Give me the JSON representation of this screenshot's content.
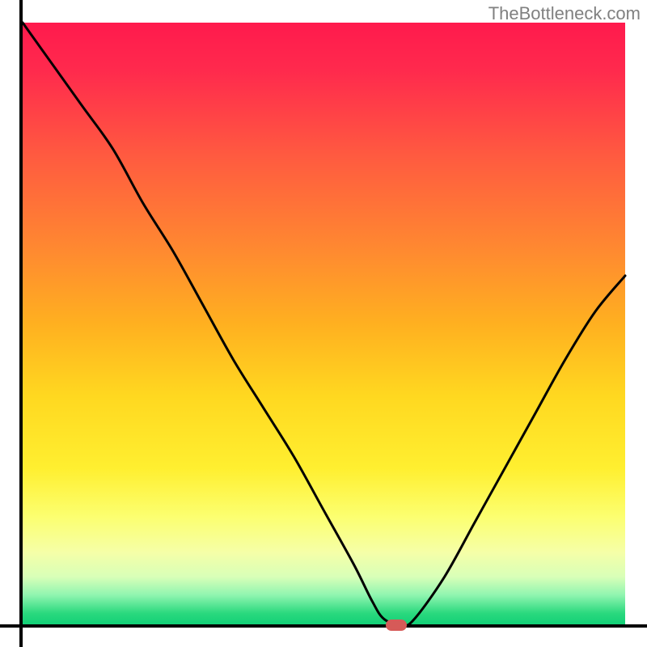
{
  "watermark": "TheBottleneck.com",
  "chart_data": {
    "type": "line",
    "title": "",
    "xlabel": "",
    "ylabel": "",
    "xlim": [
      0,
      100
    ],
    "ylim": [
      0,
      100
    ],
    "grid": false,
    "legend": false,
    "background_gradient": {
      "orientation": "vertical",
      "stops": [
        {
          "pos": 0.0,
          "color": "#ff1a4d"
        },
        {
          "pos": 0.08,
          "color": "#ff2a4d"
        },
        {
          "pos": 0.22,
          "color": "#ff5a40"
        },
        {
          "pos": 0.38,
          "color": "#ff8a30"
        },
        {
          "pos": 0.5,
          "color": "#ffb020"
        },
        {
          "pos": 0.62,
          "color": "#ffd820"
        },
        {
          "pos": 0.74,
          "color": "#ffef30"
        },
        {
          "pos": 0.82,
          "color": "#fcff70"
        },
        {
          "pos": 0.88,
          "color": "#f5ffa8"
        },
        {
          "pos": 0.92,
          "color": "#d8ffb8"
        },
        {
          "pos": 0.95,
          "color": "#90f5b0"
        },
        {
          "pos": 0.98,
          "color": "#2bd97e"
        },
        {
          "pos": 1.0,
          "color": "#10cf76"
        }
      ]
    },
    "series": [
      {
        "name": "bottleneck-curve",
        "color": "#000000",
        "x": [
          0,
          5,
          10,
          15,
          20,
          25,
          30,
          35,
          40,
          45,
          50,
          55,
          58,
          60,
          63,
          65,
          70,
          75,
          80,
          85,
          90,
          95,
          100
        ],
        "y": [
          100,
          93,
          86,
          79,
          70,
          62,
          53,
          44,
          36,
          28,
          19,
          10,
          4,
          1,
          0,
          1,
          8,
          17,
          26,
          35,
          44,
          52,
          58
        ]
      }
    ],
    "marker": {
      "name": "optimal-point",
      "shape": "rounded-rect",
      "color": "#d65a58",
      "x": 62,
      "y": 0,
      "width_frac": 0.035,
      "height_frac": 0.019
    }
  }
}
